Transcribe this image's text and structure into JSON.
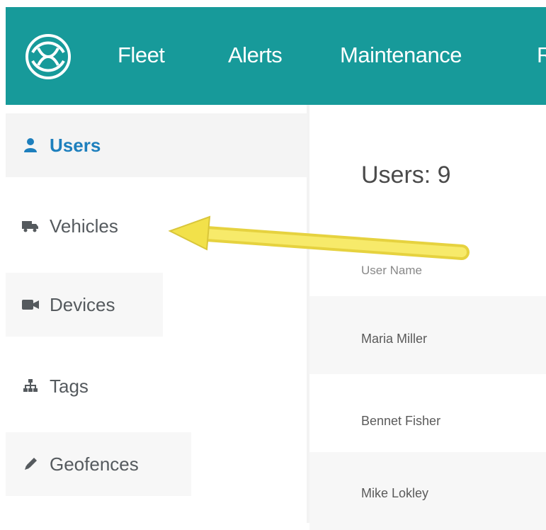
{
  "topnav": {
    "items": [
      "Fleet",
      "Alerts",
      "Maintenance",
      "R"
    ]
  },
  "sidebar": {
    "items": [
      {
        "label": "Users",
        "icon": "user-icon",
        "active": true
      },
      {
        "label": "Vehicles",
        "icon": "truck-icon"
      },
      {
        "label": "Devices",
        "icon": "video-camera-icon"
      },
      {
        "label": "Tags",
        "icon": "sitemap-icon"
      },
      {
        "label": "Geofences",
        "icon": "pencil-icon"
      }
    ]
  },
  "main": {
    "title": "Users: 9",
    "table": {
      "header": "User Name",
      "rows": [
        "Maria Miller",
        "Bennet Fisher",
        "Mike Lokley"
      ]
    }
  },
  "colors": {
    "topbar": "#179a9a",
    "active_link": "#1d7fbd",
    "annotation_arrow": "#f2e14a"
  }
}
